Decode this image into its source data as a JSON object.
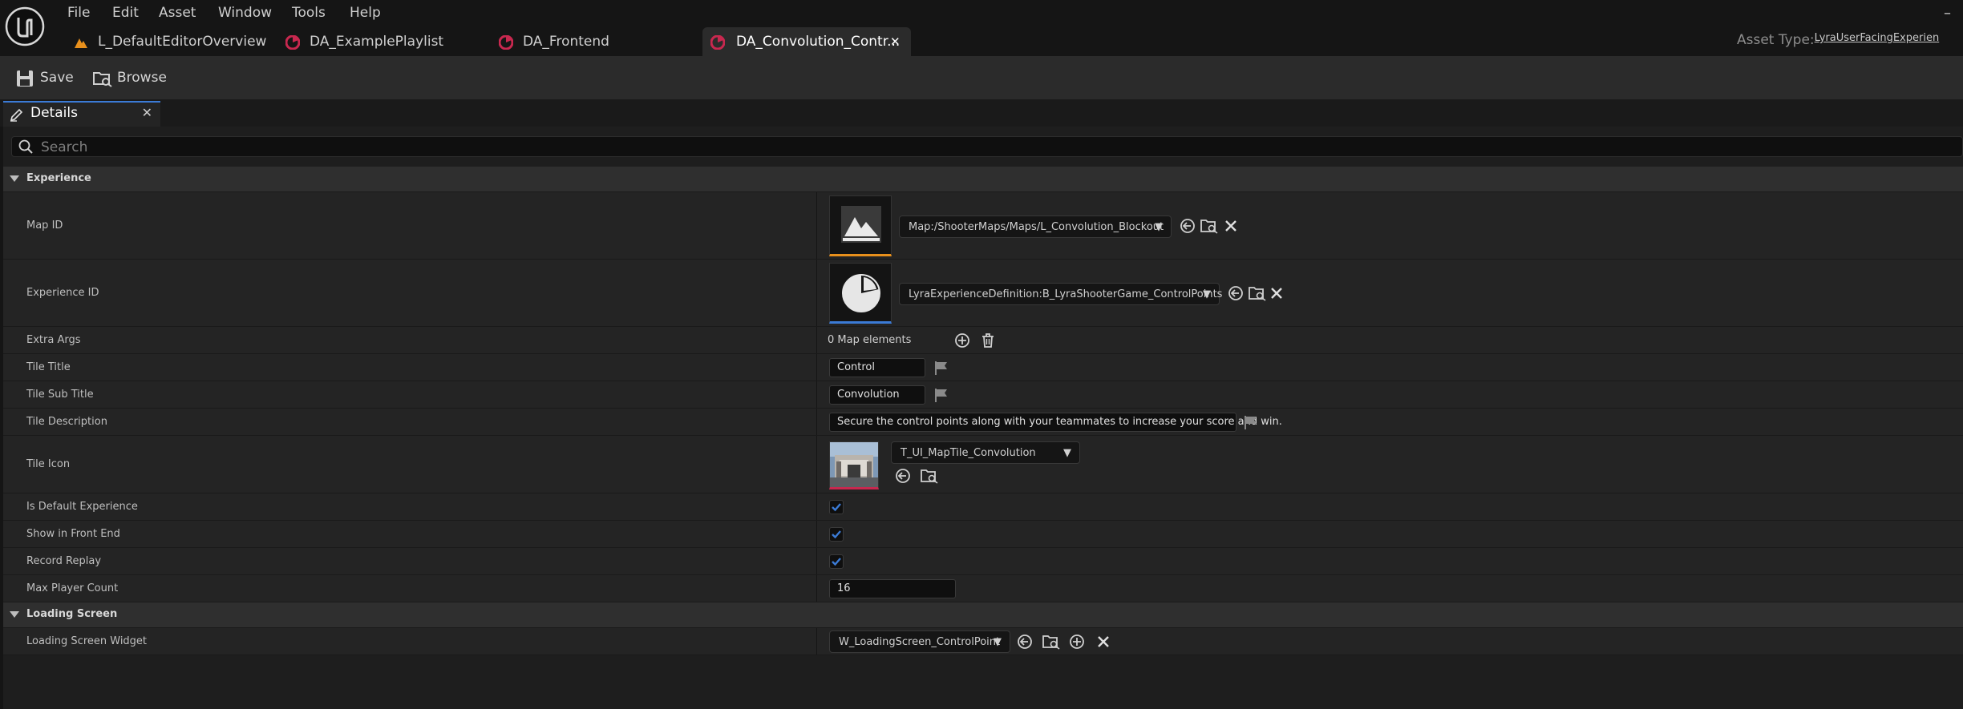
{
  "menu": {
    "items": [
      "File",
      "Edit",
      "Asset",
      "Window",
      "Tools",
      "Help"
    ]
  },
  "tabs": [
    {
      "label": "L_DefaultEditorOverview",
      "icon": "level-icon"
    },
    {
      "label": "DA_ExamplePlaylist",
      "icon": "data-asset-icon"
    },
    {
      "label": "DA_Frontend",
      "icon": "data-asset-icon"
    },
    {
      "label": "DA_Convolution_Contr...",
      "icon": "data-asset-icon",
      "active": true
    }
  ],
  "asset_type": {
    "label": "Asset Type:",
    "value": "LyraUserFacingExperien"
  },
  "toolbar": {
    "save_label": "Save",
    "browse_label": "Browse"
  },
  "details": {
    "tab_label": "Details",
    "search_placeholder": "Search",
    "categories": [
      {
        "label": "Experience"
      },
      {
        "label": "Loading Screen"
      }
    ],
    "properties": {
      "map_id": {
        "name": "Map ID",
        "value": "Map:/ShooterMaps/Maps/L_Convolution_Blockout"
      },
      "experience_id": {
        "name": "Experience ID",
        "value": "LyraExperienceDefinition:B_LyraShooterGame_ControlPoints"
      },
      "extra_args": {
        "name": "Extra Args",
        "value": "0 Map elements"
      },
      "tile_title": {
        "name": "Tile Title",
        "value": "Control"
      },
      "tile_sub_title": {
        "name": "Tile Sub Title",
        "value": "Convolution"
      },
      "tile_description": {
        "name": "Tile Description",
        "value": "Secure the control points along with your teammates to increase your score and win."
      },
      "tile_icon": {
        "name": "Tile Icon",
        "value": "T_UI_MapTile_Convolution"
      },
      "is_default_experience": {
        "name": "Is Default Experience",
        "checked": true
      },
      "show_in_front_end": {
        "name": "Show in Front End",
        "checked": true
      },
      "record_replay": {
        "name": "Record Replay",
        "checked": true
      },
      "max_player_count": {
        "name": "Max Player Count",
        "value": "16"
      },
      "loading_screen_widget": {
        "name": "Loading Screen Widget",
        "value": "W_LoadingScreen_ControlPoint"
      }
    }
  },
  "colors": {
    "accent_blue": "#3b7bd6",
    "asset_pink": "#c8284f",
    "map_orange": "#e8901c"
  }
}
